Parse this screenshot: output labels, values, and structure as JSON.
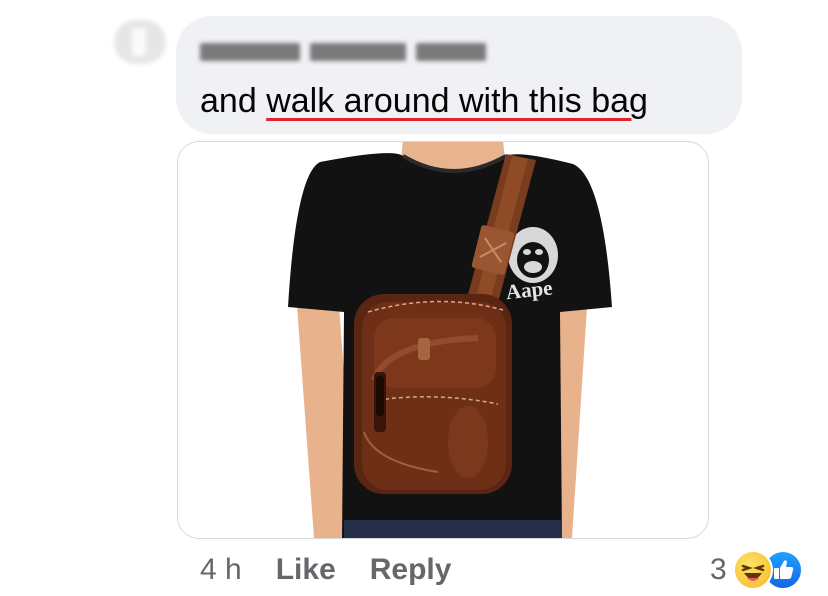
{
  "comment": {
    "text_before": "and ",
    "text_misspelled": "walk around with this bag"
  },
  "actions": {
    "time": "4 h",
    "like_label": "Like",
    "reply_label": "Reply"
  },
  "reactions": {
    "count": "3",
    "types": [
      "haha",
      "like"
    ]
  },
  "attachment": {
    "shirt_text": "Aape",
    "icon": "ape-head-logo"
  },
  "colors": {
    "bubble": "#f0f1f5",
    "spellcheck_underline": "#e0242b",
    "meta_text": "#65676b",
    "like_blue": "#1877f2"
  }
}
